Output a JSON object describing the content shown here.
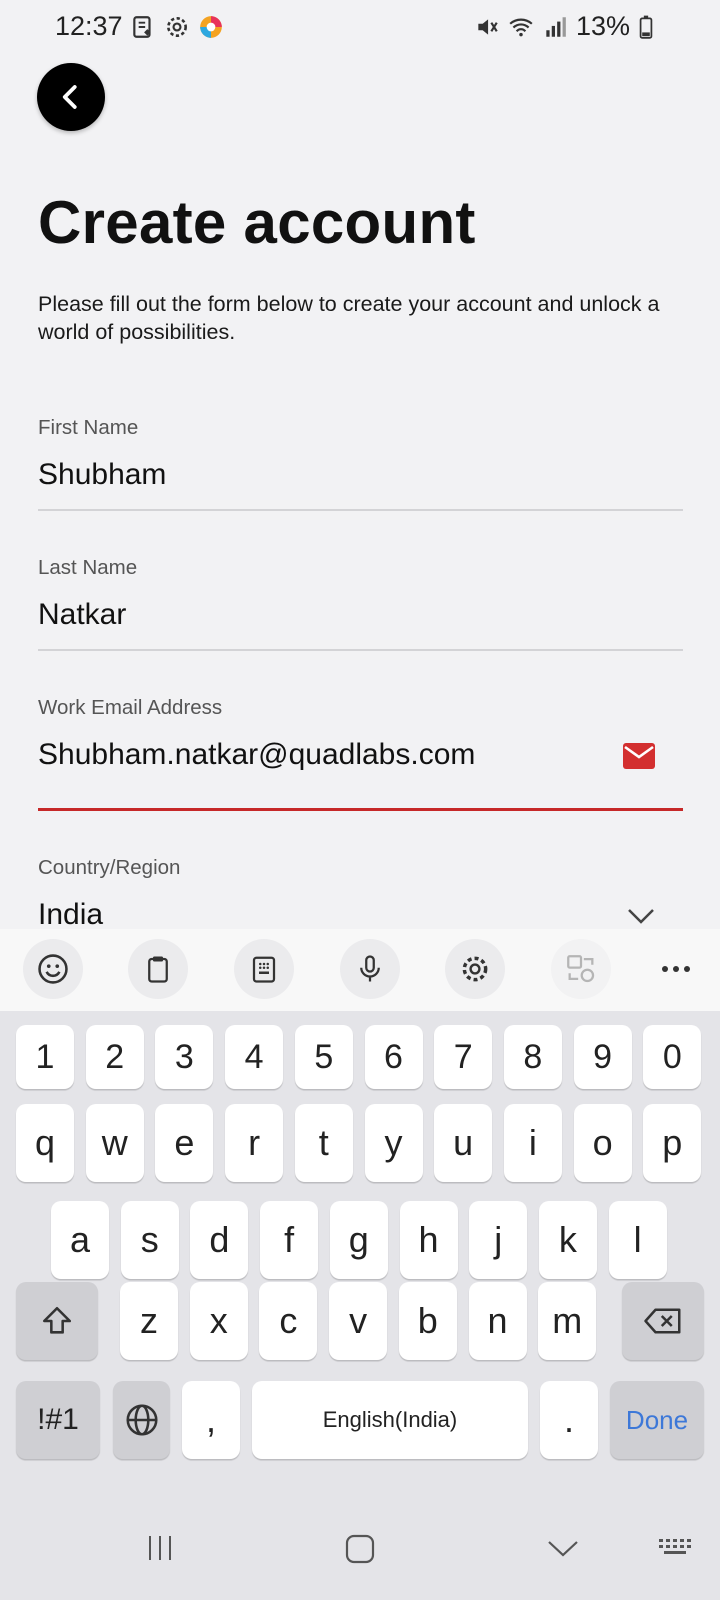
{
  "status_bar": {
    "time": "12:37",
    "battery": "13%",
    "left_icons": [
      "notes-icon",
      "settings-gear-icon",
      "app-icon"
    ],
    "right_icons": [
      "mute-icon",
      "wifi-icon",
      "signal-icon",
      "battery-icon"
    ]
  },
  "header": {
    "title": "Create account",
    "description": "Please fill out the form below to create your account and unlock a world of possibilities."
  },
  "form": {
    "first_name": {
      "label": "First Name",
      "value": "Shubham"
    },
    "last_name": {
      "label": "Last Name",
      "value": "Natkar"
    },
    "email": {
      "label": "Work Email Address",
      "value": "Shubham.natkar@quadlabs.com",
      "icon_color": "#d32f2f"
    },
    "country": {
      "label": "Country/Region",
      "value": "India"
    }
  },
  "keyboard": {
    "toolbar": [
      "emoji-icon",
      "clipboard-icon",
      "keypad-icon",
      "microphone-icon",
      "settings-icon",
      "translate-icon",
      "more-icon"
    ],
    "row_numbers": [
      "1",
      "2",
      "3",
      "4",
      "5",
      "6",
      "7",
      "8",
      "9",
      "0"
    ],
    "row_1": [
      "q",
      "w",
      "e",
      "r",
      "t",
      "y",
      "u",
      "i",
      "o",
      "p"
    ],
    "row_2": [
      "a",
      "s",
      "d",
      "f",
      "g",
      "h",
      "j",
      "k",
      "l"
    ],
    "row_3": [
      "z",
      "x",
      "c",
      "v",
      "b",
      "n",
      "m"
    ],
    "symbols_key": "!#1",
    "comma_key": ",",
    "space_key": "English(India)",
    "period_key": ".",
    "done_key": "Done",
    "accent_color": "#3d78d8"
  },
  "navigation": [
    "recent-apps-icon",
    "home-icon",
    "back-icon",
    "keyboard-hide-icon"
  ]
}
